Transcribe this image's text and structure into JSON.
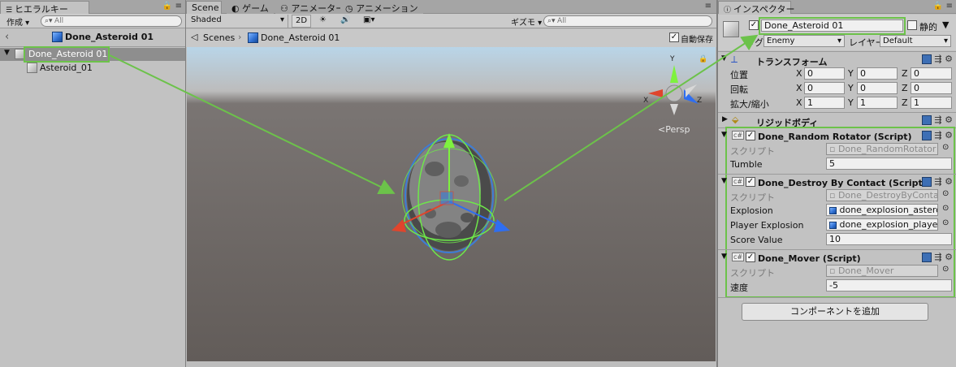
{
  "hierarchy": {
    "tab_label": "ヒエラルキー",
    "create_label": "作成 ▾",
    "search_placeholder": "All",
    "scene_name": "Done_Asteroid 01",
    "items": [
      {
        "label": "Done_Asteroid 01"
      },
      {
        "label": "Asteroid_01"
      }
    ]
  },
  "scene": {
    "tabs": [
      {
        "label": "Scene"
      },
      {
        "label": "ゲーム"
      },
      {
        "label": "アニメーター"
      },
      {
        "label": "アニメーション"
      }
    ],
    "shading_mode": "Shaded",
    "mode_2d": "2D",
    "gizmos_label": "ギズモ ▾",
    "search_placeholder": "All",
    "breadcrumb_scenes": "Scenes",
    "breadcrumb_object": "Done_Asteroid 01",
    "autosave_label": "自動保存",
    "persp_label": "<Persp",
    "axis_x": "X",
    "axis_y": "Y",
    "axis_z": "Z"
  },
  "inspector": {
    "tab_label": "インスペクター",
    "object_name": "Done_Asteroid 01",
    "static_label": "静的",
    "tag_label": "タグ",
    "tag_value": "Enemy",
    "layer_label": "レイヤー",
    "layer_value": "Default",
    "transform": {
      "title": "トランスフォーム",
      "rows": [
        {
          "label": "位置",
          "x": "0",
          "y": "0",
          "z": "0"
        },
        {
          "label": "回転",
          "x": "0",
          "y": "0",
          "z": "0"
        },
        {
          "label": "拡大/縮小",
          "x": "1",
          "y": "1",
          "z": "1"
        }
      ],
      "axis_x": "X",
      "axis_y": "Y",
      "axis_z": "Z"
    },
    "rigidbody_title": "リジッドボディ",
    "components": [
      {
        "title": "Done_Random Rotator (Script)",
        "script_label": "スクリプト",
        "script_value": "Done_RandomRotator",
        "fields": [
          {
            "label": "Tumble",
            "value": "5"
          }
        ]
      },
      {
        "title": "Done_Destroy By Contact (Script",
        "script_label": "スクリプト",
        "script_value": "Done_DestroyByContact",
        "fields": [
          {
            "label": "Explosion",
            "value": "done_explosion_asteroid"
          },
          {
            "label": "Player Explosion",
            "value": "done_explosion_player"
          },
          {
            "label": "Score Value",
            "value": "10"
          }
        ]
      },
      {
        "title": "Done_Mover (Script)",
        "script_label": "スクリプト",
        "script_value": "Done_Mover",
        "fields": [
          {
            "label": "速度",
            "value": "-5"
          }
        ]
      }
    ],
    "add_component_label": "コンポーネントを追加"
  },
  "colors": {
    "highlight_green": "#6cc24a",
    "selection_gray": "#8e8e8e",
    "scene_ground": "#5f5956",
    "scene_sky": "#b8d4e6"
  }
}
